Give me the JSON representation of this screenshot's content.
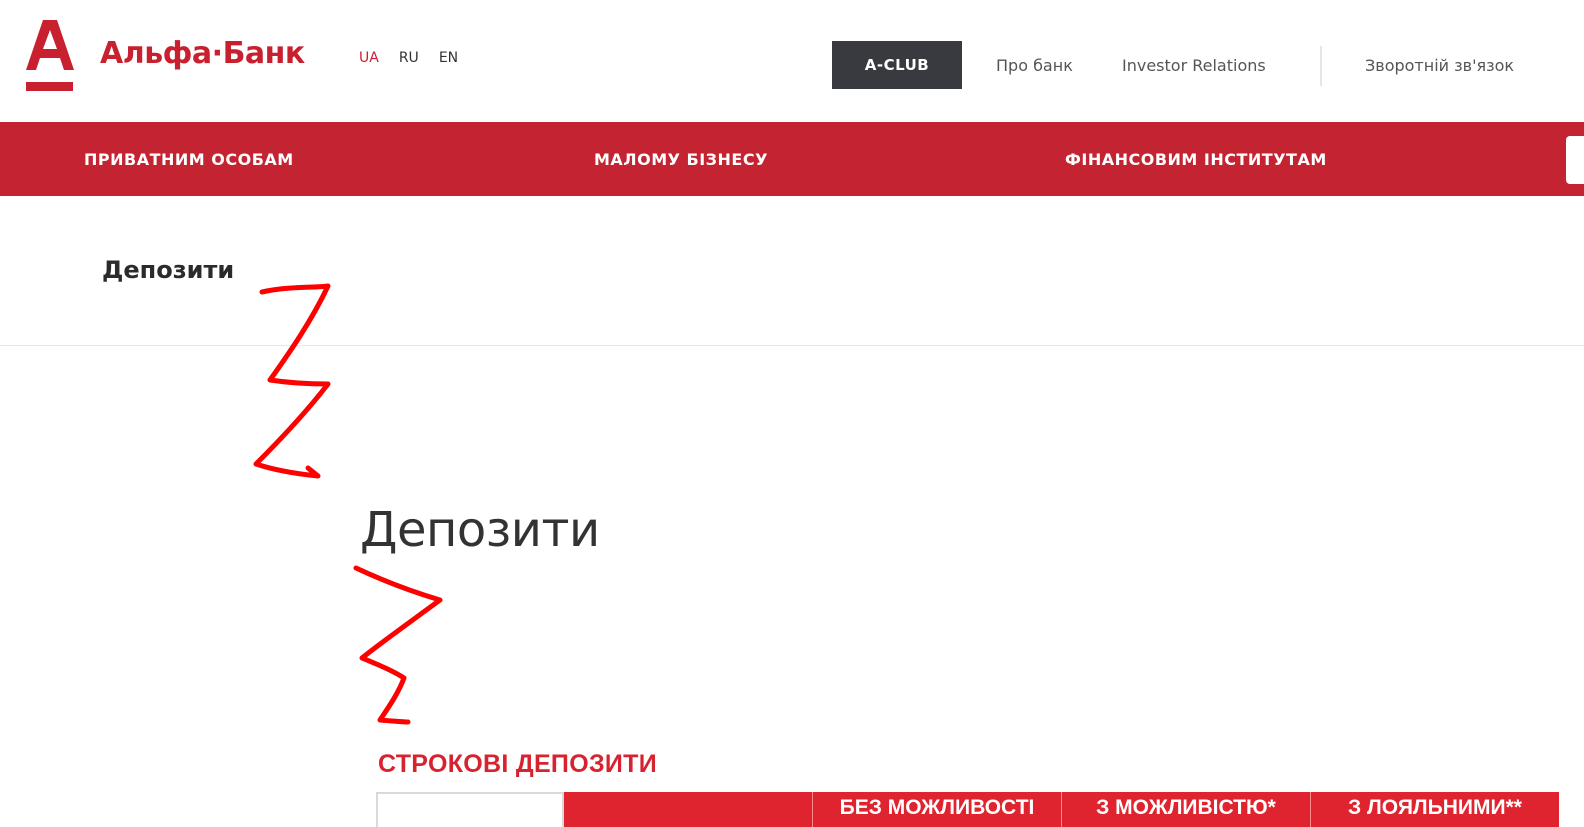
{
  "header": {
    "logo_letter": "А",
    "brand_name": "Альфа·Банк",
    "languages": [
      {
        "code": "UA",
        "active": true
      },
      {
        "code": "RU",
        "active": false
      },
      {
        "code": "EN",
        "active": false
      }
    ],
    "aclub_label": "A-CLUB",
    "links": {
      "about": "Про банк",
      "investor": "Investor Relations",
      "feedback": "Зворотній зв'язок"
    }
  },
  "nav": {
    "items": [
      "ПРИВАТНИМ ОСОБАМ",
      "МАЛОМУ БІЗНЕСУ",
      "ФІНАНСОВИМ ІНСТИТУТАМ"
    ]
  },
  "page": {
    "title": "Депозити"
  },
  "content": {
    "heading": "Депозити",
    "section_heading": "СТРОКОВІ ДЕПОЗИТИ",
    "table_headers": [
      "",
      "",
      "БЕЗ МОЖЛИВОСТІ",
      "З МОЖЛИВІСТЮ*",
      "З ЛОЯЛЬНИМИ**"
    ]
  },
  "colors": {
    "brand_red": "#c42332",
    "table_red": "#e0242f",
    "aclub_bg": "#383a40",
    "annotation_red": "#ff0000"
  }
}
